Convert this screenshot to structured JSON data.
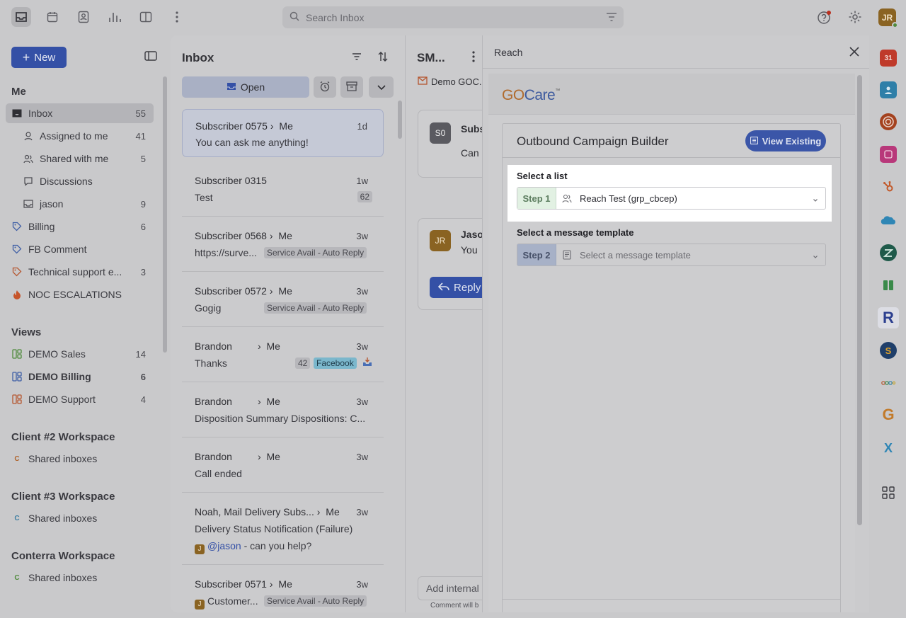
{
  "topbar": {
    "search_placeholder": "Search Inbox",
    "avatar_initials": "JR"
  },
  "sidebar": {
    "new_label": "New",
    "me_heading": "Me",
    "items": [
      {
        "label": "Inbox",
        "count": "55"
      },
      {
        "label": "Assigned to me",
        "count": "41"
      },
      {
        "label": "Shared with me",
        "count": "5"
      },
      {
        "label": "Discussions",
        "count": ""
      },
      {
        "label": "jason",
        "count": "9"
      },
      {
        "label": "Billing",
        "count": "6"
      },
      {
        "label": "FB Comment",
        "count": ""
      },
      {
        "label": "Technical support e...",
        "count": "3"
      },
      {
        "label": "NOC ESCALATIONS",
        "count": ""
      }
    ],
    "views_heading": "Views",
    "views": [
      {
        "label": "DEMO Sales",
        "count": "14"
      },
      {
        "label": "DEMO Billing",
        "count": "6"
      },
      {
        "label": "DEMO Support",
        "count": "4"
      }
    ],
    "workspaces": [
      {
        "heading": "Client #2 Workspace",
        "item": "Shared inboxes",
        "letter": "C",
        "color": "#b0642c"
      },
      {
        "heading": "Client #3 Workspace",
        "item": "Shared inboxes",
        "letter": "C",
        "color": "#3e7fa3"
      },
      {
        "heading": "Conterra Workspace",
        "item": "Shared inboxes",
        "letter": "C",
        "color": "#4f8a3c"
      }
    ]
  },
  "inbox": {
    "title": "Inbox",
    "open_label": "Open",
    "conversations": [
      {
        "who": "Subscriber 0575",
        "me": "Me",
        "when": "1d",
        "snippet": "You can ask me anything!"
      },
      {
        "who": "Subscriber 0315",
        "me": "",
        "when": "1w",
        "snippet": "Test",
        "num": "62"
      },
      {
        "who": "Subscriber 0568",
        "me": "Me",
        "when": "3w",
        "snippet": "https://surve...",
        "tag": "Service Avail - Auto Reply"
      },
      {
        "who": "Subscriber 0572",
        "me": "Me",
        "when": "3w",
        "snippet": "Gogig",
        "tag": "Service Avail - Auto Reply"
      },
      {
        "who": "Brandon",
        "me": "Me",
        "when": "3w",
        "snippet": "Thanks",
        "num": "42",
        "tag": "Facebook"
      },
      {
        "who": "Brandon",
        "me": "Me",
        "when": "3w",
        "snippet": "Disposition Summary Dispositions: C..."
      },
      {
        "who": "Brandon",
        "me": "Me",
        "when": "3w",
        "snippet": "Call ended"
      },
      {
        "who": "Noah, Mail Delivery Subs...",
        "me": "Me",
        "when": "3w",
        "snippet": "Delivery Status Notification (Failure)",
        "snippet2_mention": "@jason",
        "snippet2_rest": " - can you help?"
      },
      {
        "who": "Subscriber 0571",
        "me": "Me",
        "when": "3w",
        "snippet": "Customer...",
        "tag": "Service Avail - Auto Reply"
      }
    ]
  },
  "detail": {
    "title": "SM...",
    "tab": "Demo GOC...",
    "card1_initials": "S0",
    "card1_name": "Subs",
    "card1_text": "Can",
    "card2_initials": "JR",
    "card2_name": "Jaso",
    "card2_text": "You",
    "reply_label": "Reply",
    "note_placeholder": "Add internal",
    "note_sub": "Comment will b"
  },
  "reach": {
    "panel_title": "Reach",
    "logo_go": "GO",
    "logo_care": "Care",
    "logo_tm": "™",
    "builder_title": "Outbound Campaign Builder",
    "view_existing_label": "View Existing",
    "step1": {
      "label": "Select a list",
      "tag": "Step 1",
      "value": "Reach Test (grp_cbcep)"
    },
    "step2": {
      "label": "Select a message template",
      "tag": "Step 2",
      "placeholder": "Select a message template"
    }
  },
  "apps": {
    "calendar_day": "31",
    "r_letter": "R",
    "s_letter": "S",
    "g_letter": "G",
    "x_letter": "X"
  },
  "colors": {
    "accent": "#3450a6",
    "step1_tag_bg": "#e2f1e3",
    "highlight": "#ffffff"
  }
}
